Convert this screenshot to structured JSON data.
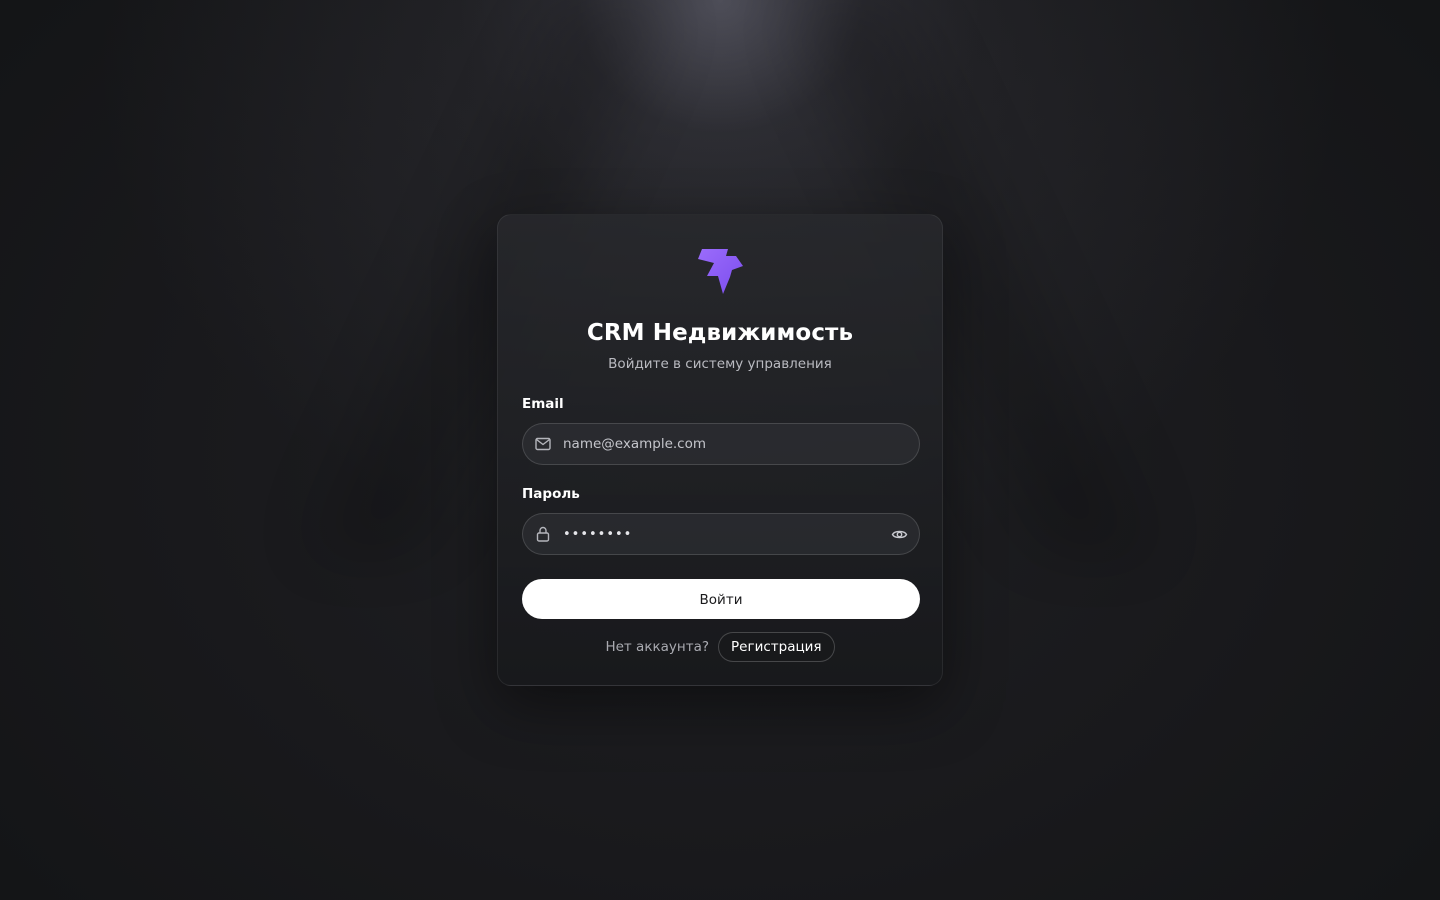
{
  "app": {
    "title": "CRM Недвижимость",
    "subtitle": "Войдите в систему управления",
    "logo_icon": "lightning-bolt-icon",
    "accent_color": "#8b5cf6"
  },
  "form": {
    "email": {
      "label": "Email",
      "placeholder": "name@example.com",
      "value": "",
      "icon": "mail-icon"
    },
    "password": {
      "label": "Пароль",
      "value": "••••••••",
      "icon": "lock-icon",
      "toggle_icon": "eye-icon"
    },
    "submit_label": "Войти"
  },
  "footer": {
    "question": "Нет аккаунта?",
    "register_label": "Регистрация"
  }
}
